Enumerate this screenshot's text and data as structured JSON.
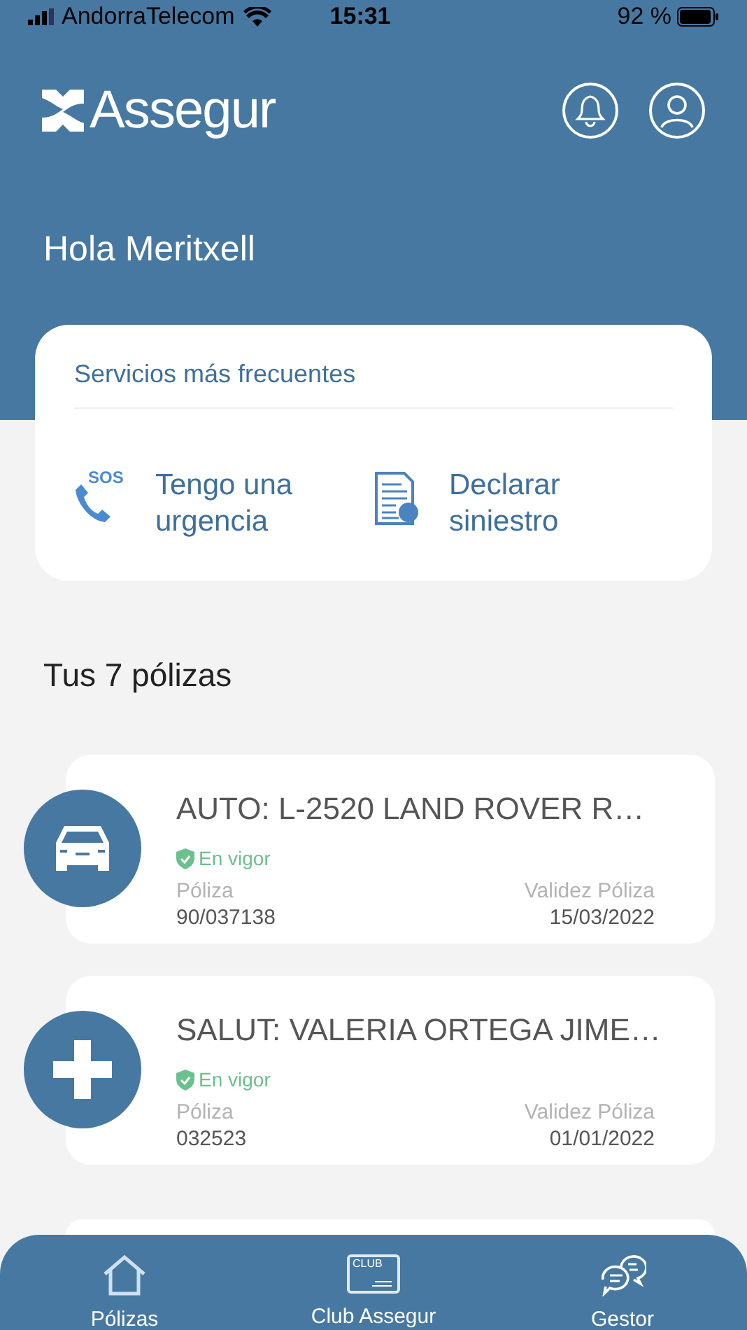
{
  "status_bar": {
    "carrier": "AndorraTelecom",
    "time": "15:31",
    "battery": "92 %"
  },
  "header": {
    "logo": "Assegur"
  },
  "greeting": "Hola Meritxell",
  "services": {
    "title": "Servicios más frecuentes",
    "items": [
      {
        "kind": "sos",
        "icon_text": "SOS",
        "label": "Tengo una urgencia"
      },
      {
        "kind": "claim",
        "label": "Declarar siniestro"
      }
    ]
  },
  "policies_title": "Tus 7 pólizas",
  "policies": [
    {
      "kind": "car",
      "title": "AUTO: L-2520 LAND ROVER R…",
      "status": "En vigor",
      "policy_label": "Póliza",
      "policy_number": "90/037138",
      "validity_label": "Validez Póliza",
      "validity_date": "15/03/2022"
    },
    {
      "kind": "health",
      "title": "SALUT: VALERIA ORTEGA JIME…",
      "status": "En vigor",
      "policy_label": "Póliza",
      "policy_number": "032523",
      "validity_label": "Validez Póliza",
      "validity_date": "01/01/2022"
    }
  ],
  "nav": [
    {
      "kind": "home",
      "label": "Pólizas"
    },
    {
      "kind": "club",
      "icon_text": "CLUB",
      "label": "Club Assegur"
    },
    {
      "kind": "chat",
      "label": "Gestor"
    }
  ]
}
